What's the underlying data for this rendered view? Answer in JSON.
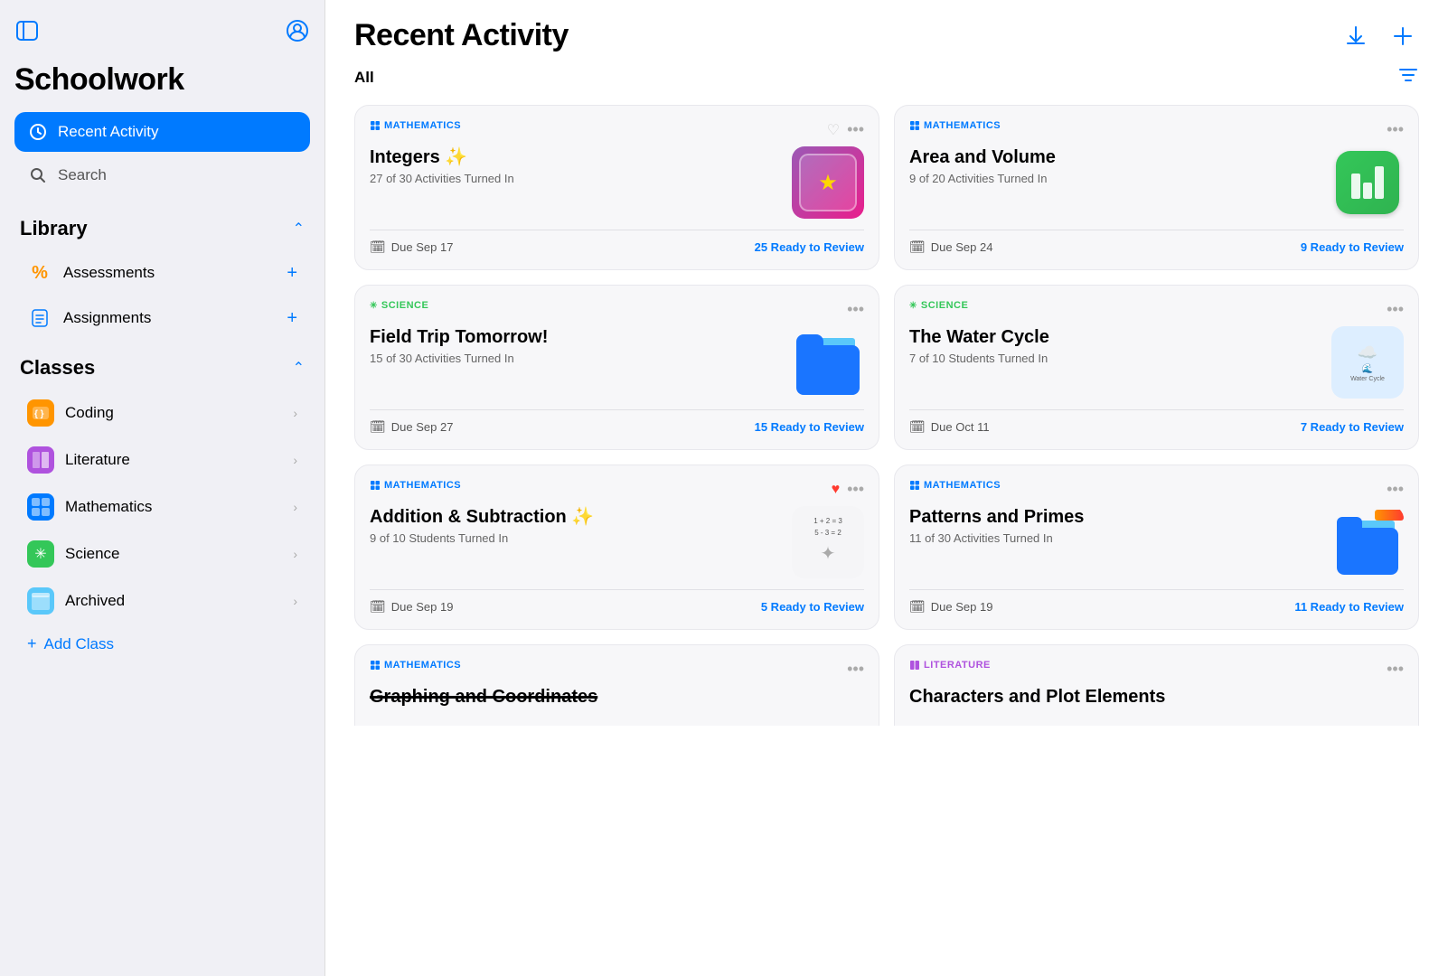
{
  "sidebar": {
    "title": "Schoolwork",
    "nav": {
      "recent_activity": "Recent Activity",
      "search": "Search"
    },
    "library": {
      "label": "Library",
      "items": [
        {
          "id": "assessments",
          "label": "Assessments",
          "icon": "%"
        },
        {
          "id": "assignments",
          "label": "Assignments",
          "icon": "doc"
        }
      ]
    },
    "classes": {
      "label": "Classes",
      "items": [
        {
          "id": "coding",
          "label": "Coding",
          "color": "#FF9500"
        },
        {
          "id": "literature",
          "label": "Literature",
          "color": "#AF52DE"
        },
        {
          "id": "mathematics",
          "label": "Mathematics",
          "color": "#007AFF"
        },
        {
          "id": "science",
          "label": "Science",
          "color": "#34C759"
        }
      ],
      "archived": "Archived",
      "add_class": "Add Class"
    }
  },
  "main": {
    "title": "Recent Activity",
    "filter_label": "All",
    "cards": [
      {
        "id": "integers",
        "subject": "MATHEMATICS",
        "subject_type": "math",
        "title": "Integers ✨",
        "subtitle": "27 of 30 Activities Turned In",
        "due": "Due Sep 17",
        "review": "25 Ready to Review",
        "thumb_type": "integers"
      },
      {
        "id": "area-volume",
        "subject": "MATHEMATICS",
        "subject_type": "math",
        "title": "Area and Volume",
        "subtitle": "9 of 20 Activities Turned In",
        "due": "Due Sep 24",
        "review": "9 Ready to Review",
        "thumb_type": "numbers"
      },
      {
        "id": "field-trip",
        "subject": "SCIENCE",
        "subject_type": "science",
        "title": "Field Trip Tomorrow!",
        "subtitle": "15 of 30 Activities Turned In",
        "due": "Due Sep 27",
        "review": "15 Ready to Review",
        "thumb_type": "folder-blue"
      },
      {
        "id": "water-cycle",
        "subject": "SCIENCE",
        "subject_type": "science",
        "title": "The Water Cycle",
        "subtitle": "7 of 10 Students Turned In",
        "due": "Due Oct 11",
        "review": "7 Ready to Review",
        "thumb_type": "water-cycle"
      },
      {
        "id": "addition-subtraction",
        "subject": "MATHEMATICS",
        "subject_type": "math",
        "title": "Addition & Subtraction ✨",
        "subtitle": "9 of 10 Students Turned In",
        "due": "Due Sep 19",
        "review": "5 Ready to Review",
        "thumb_type": "addition",
        "has_heart": true
      },
      {
        "id": "patterns-primes",
        "subject": "MATHEMATICS",
        "subject_type": "math",
        "title": "Patterns and Primes",
        "subtitle": "11 of 30 Activities Turned In",
        "due": "Due Sep 19",
        "review": "11 Ready to Review",
        "thumb_type": "patterns-folder"
      },
      {
        "id": "graphing",
        "subject": "MATHEMATICS",
        "subject_type": "math",
        "title": "Graphing and Coordinates",
        "subtitle": "",
        "due": "",
        "review": "",
        "thumb_type": "none",
        "partial": true
      },
      {
        "id": "characters-plot",
        "subject": "LITERATURE",
        "subject_type": "literature",
        "title": "Characters and Plot Elements",
        "subtitle": "",
        "due": "",
        "review": "",
        "thumb_type": "none",
        "partial": true
      }
    ]
  }
}
